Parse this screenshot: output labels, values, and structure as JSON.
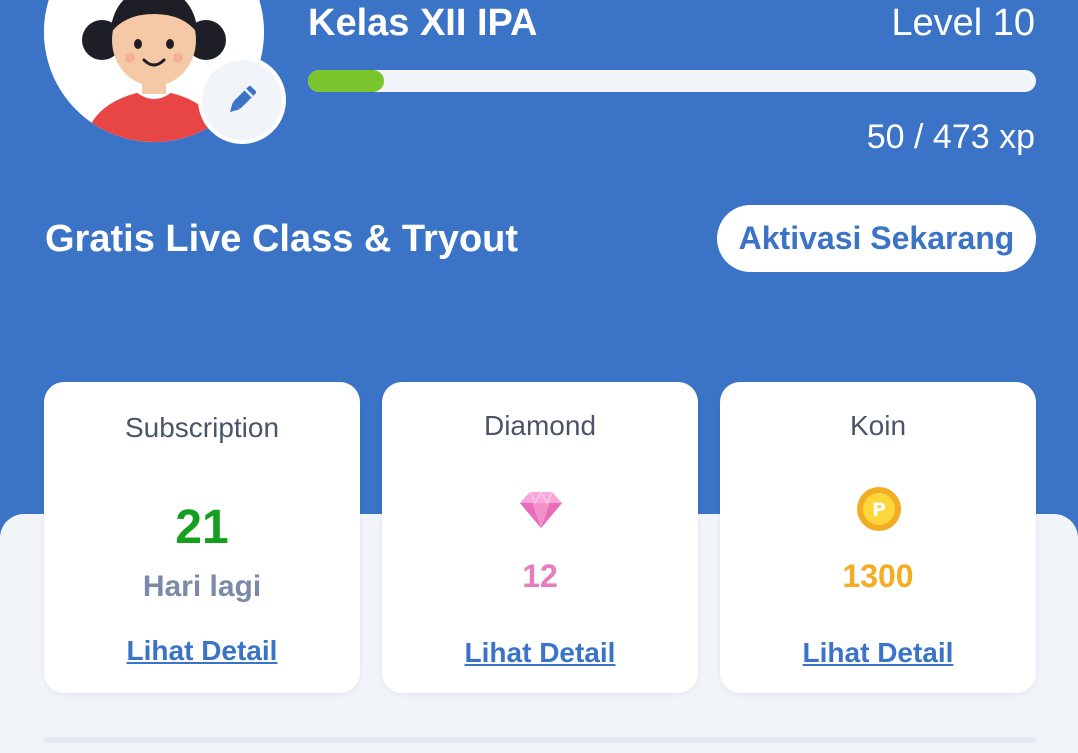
{
  "header": {
    "class_name": "Kelas XII IPA",
    "level": "Level 10",
    "xp_text": "50 / 473 xp",
    "xp_current": 50,
    "xp_max": 473,
    "xp_progress_fraction": 0.105
  },
  "promo": {
    "text": "Gratis Live Class & Tryout",
    "button_label": "Aktivasi Sekarang"
  },
  "cards": {
    "subscription": {
      "title": "Subscription",
      "value": "21",
      "unit": "Hari lagi",
      "link": "Lihat Detail"
    },
    "diamond": {
      "title": "Diamond",
      "icon": "diamond-icon",
      "value": "12",
      "link": "Lihat Detail"
    },
    "koin": {
      "title": "Koin",
      "icon": "coin-icon",
      "value": "1300",
      "link": "Lihat Detail"
    }
  },
  "colors": {
    "background": "#3b73c6",
    "progress_fill": "#7ac52c",
    "subscription_value": "#14a01e",
    "diamond_value": "#e97bbf",
    "koin_value": "#f2ad24"
  }
}
